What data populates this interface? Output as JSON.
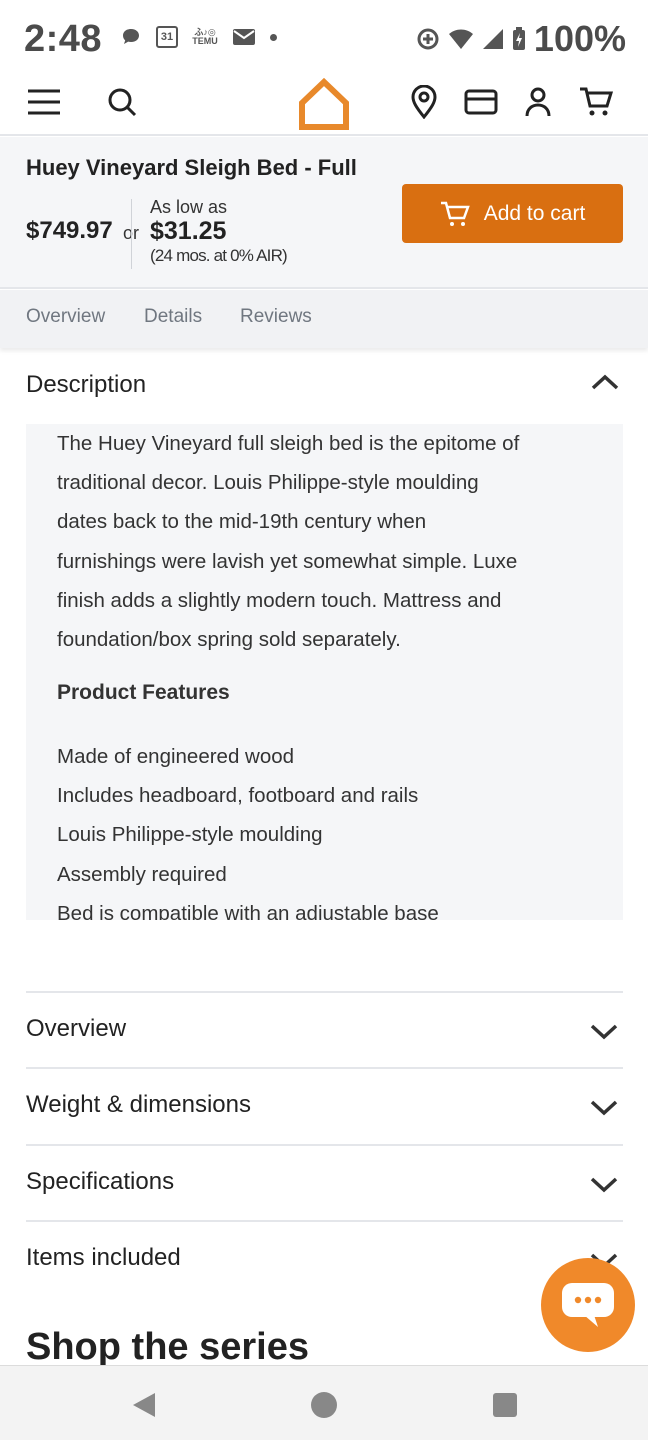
{
  "status_bar": {
    "time": "2:48",
    "calendar_day": "31",
    "temu_text": "TEMU",
    "battery_percent": "100%"
  },
  "header": {
    "menu_icon": "hamburger-icon",
    "search_icon": "search-icon",
    "logo_icon": "house-logo-icon",
    "location_icon": "location-pin-icon",
    "card_icon": "credit-card-icon",
    "account_icon": "user-icon",
    "cart_icon": "cart-icon",
    "brand_color": "#e8892b"
  },
  "product_bar": {
    "title": "Huey Vineyard Sleigh Bed - Full",
    "price": "$749.97",
    "or_text": "or",
    "as_low_as": "As low as",
    "monthly_price": "$31.25",
    "terms": "(24 mos. at 0% AIR)",
    "add_to_cart_label": "Add to cart",
    "add_to_cart_color": "#d96f11"
  },
  "tabs": [
    "Overview",
    "Details",
    "Reviews"
  ],
  "description": {
    "title": "Description",
    "lines": [
      "The Huey Vineyard full sleigh bed is the epitome of",
      "traditional decor. Louis Philippe-style moulding",
      "dates back to the mid-19th century when",
      "furnishings were lavish yet somewhat simple. Luxe",
      "finish adds a slightly modern touch. Mattress and",
      "foundation/box spring sold separately."
    ],
    "features_title": "Product Features",
    "features": [
      "Made of engineered wood",
      "Includes headboard, footboard and rails",
      "Louis Philippe-style moulding",
      "Assembly required",
      "Bed is compatible with an adjustable base"
    ]
  },
  "accordions": [
    {
      "title": "Overview"
    },
    {
      "title": "Weight & dimensions"
    },
    {
      "title": "Specifications"
    },
    {
      "title": "Items included"
    }
  ],
  "series_title": "Shop the series",
  "chat_icon": "chat-bubble-icon",
  "nav": {
    "back_icon": "back-triangle-icon",
    "home_icon": "home-circle-icon",
    "recents_icon": "recents-square-icon"
  }
}
